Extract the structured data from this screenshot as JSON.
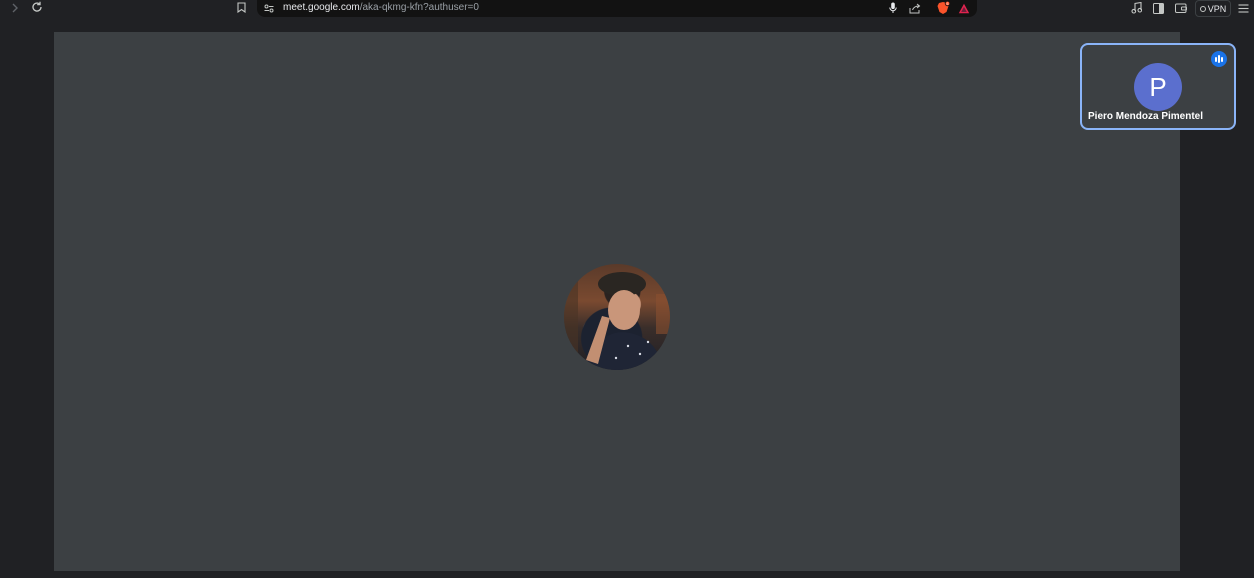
{
  "browser": {
    "url_host": "meet.google.com",
    "url_path": "/aka-qkmg-kfn?authuser=0",
    "vpn_label": "VPN"
  },
  "meet": {
    "self_tile": {
      "initial": "P",
      "name": "Piero Mendoza Pimentel",
      "avatar_color": "#5b6fce",
      "highlight_color": "#8ab4f8",
      "speaking": true
    }
  }
}
